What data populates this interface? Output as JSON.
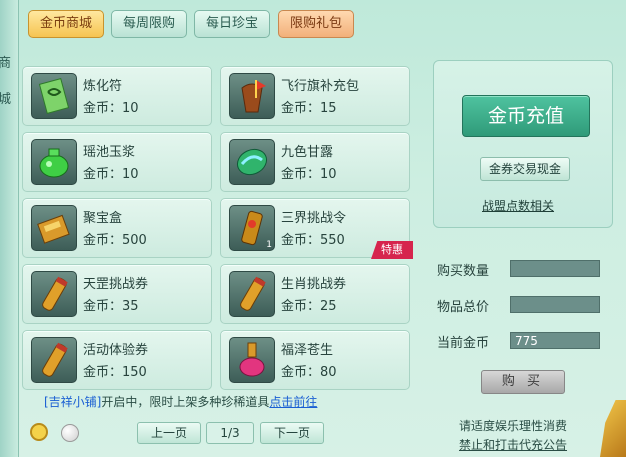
{
  "tabs": [
    {
      "label": "金币商城",
      "active": true
    },
    {
      "label": "每周限购",
      "active": false
    },
    {
      "label": "每日珍宝",
      "active": false
    },
    {
      "label": "限购礼包",
      "active": false
    }
  ],
  "side_chars": [
    "商",
    "城"
  ],
  "items": [
    {
      "name": "炼化符",
      "price": "金币：10",
      "icon": "talisman-icon"
    },
    {
      "name": "飞行旗补充包",
      "price": "金币：15",
      "icon": "flag-pack-icon"
    },
    {
      "name": "瑶池玉浆",
      "price": "金币：10",
      "icon": "jade-pot-icon"
    },
    {
      "name": "九色甘露",
      "price": "金币：10",
      "icon": "nectar-gem-icon"
    },
    {
      "name": "聚宝盒",
      "price": "金币：500",
      "icon": "treasure-box-icon"
    },
    {
      "name": "三界挑战令",
      "price": "金币：550",
      "icon": "challenge-token-icon",
      "qty": "1",
      "badge": "特惠"
    },
    {
      "name": "天罡挑战券",
      "price": "金币：35",
      "icon": "scroll-icon"
    },
    {
      "name": "生肖挑战券",
      "price": "金币：25",
      "icon": "scroll-icon"
    },
    {
      "name": "活动体验券",
      "price": "金币：150",
      "icon": "scroll-icon"
    },
    {
      "name": "福泽苍生",
      "price": "金币：80",
      "icon": "potion-bottle-icon"
    }
  ],
  "notice": {
    "shop": "[吉祥小铺]",
    "text": "开启中，限时上架多种珍稀道具",
    "link": "点击前往"
  },
  "pager": {
    "prev": "上一页",
    "page": "1/3",
    "next": "下一页"
  },
  "side": {
    "recharge": "金币充值",
    "exchange": "金券交易现金",
    "alliance": "战盟点数相关"
  },
  "purchase": {
    "qty_label": "购买数量",
    "qty_value": "",
    "total_label": "物品总价",
    "total_value": "",
    "gold_label": "当前金币",
    "gold_value": "775",
    "buy": "购 买"
  },
  "footer": {
    "line1": "请适度娱乐理性消费",
    "line2": "禁止和打击代充公告"
  },
  "colors": {
    "active_tab": "#f6c451",
    "badge": "#d6254d",
    "recharge": "#2f9a79",
    "link": "#1a5fd3"
  }
}
